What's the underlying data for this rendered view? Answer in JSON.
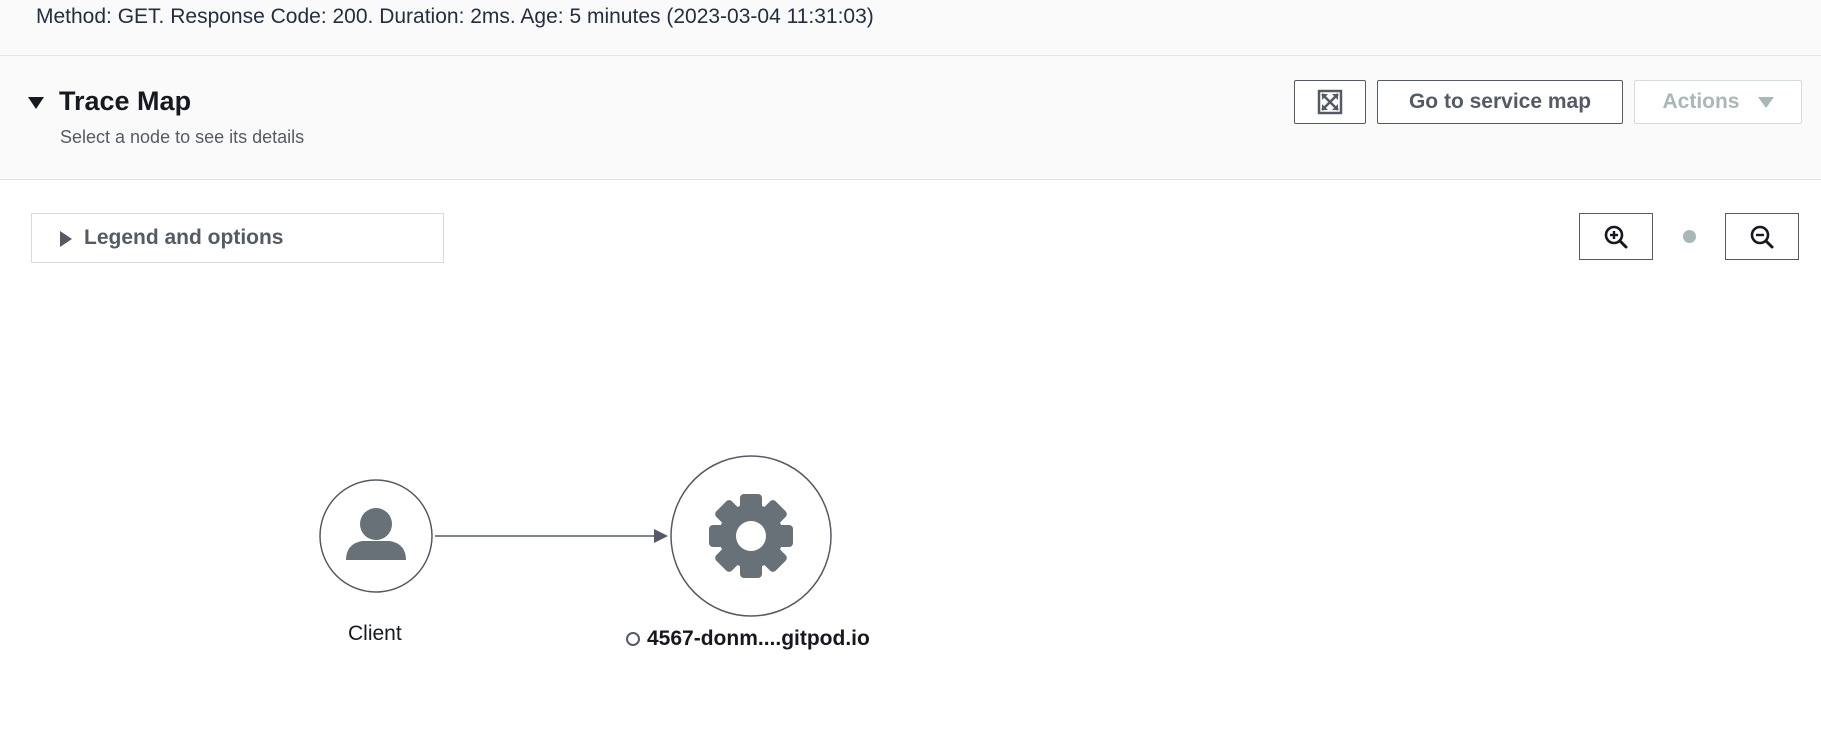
{
  "trace_info": {
    "summary": "Method: GET. Response Code: 200. Duration: 2ms. Age: 5 minutes (2023-03-04 11:31:03)"
  },
  "trace_map": {
    "title": "Trace Map",
    "subtitle": "Select a node to see its details",
    "buttons": {
      "expand_icon": "expand-icon",
      "go_to_service_map": "Go to service map",
      "actions": "Actions"
    }
  },
  "legend": {
    "label": "Legend and options"
  },
  "zoom": {
    "zoom_in_icon": "zoom-in-icon",
    "reset_icon": "dot-icon",
    "zoom_out_icon": "zoom-out-icon"
  },
  "nodes": {
    "client": {
      "label": "Client",
      "icon": "user-icon"
    },
    "service": {
      "label": "4567-donm....gitpod.io",
      "icon": "gear-icon",
      "status_icon": "status-ring-icon"
    }
  },
  "colors": {
    "icon_gray": "#687078",
    "border_dark": "#545b64",
    "disabled": "#aab7b8",
    "header_bg": "#fafafa"
  }
}
